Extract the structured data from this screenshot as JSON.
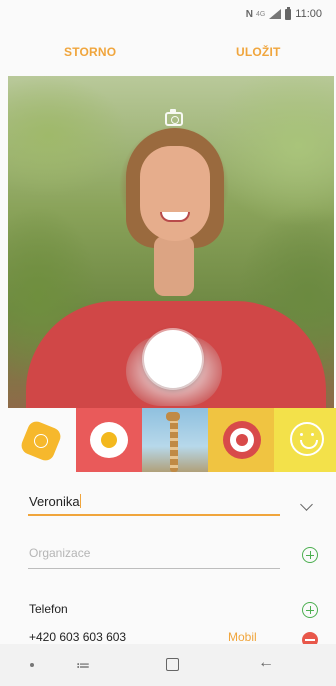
{
  "status_bar": {
    "nfc": "N",
    "network": "4G",
    "time": "11:00"
  },
  "action_bar": {
    "cancel_label": "STORNO",
    "save_label": "ULOŽIT"
  },
  "photo": {
    "camera_icon": "camera-icon",
    "shutter_icon": "shutter-button"
  },
  "stickers": [
    {
      "name": "flower-badge-sticker",
      "background": "#fafafa"
    },
    {
      "name": "fried-egg-sticker",
      "background": "#e95a5a"
    },
    {
      "name": "giraffe-sticker",
      "background": "#8fc0df"
    },
    {
      "name": "target-sticker",
      "background": "#f0c441"
    },
    {
      "name": "smiley-sticker",
      "background": "#f3e14a"
    }
  ],
  "form": {
    "name_value": "Veronika",
    "organization_placeholder": "Organizace",
    "phone_label": "Telefon",
    "phone_number": "+420 603 603 603",
    "phone_type": "Mobil"
  },
  "colors": {
    "accent": "#f0a53c",
    "add": "#4caf50",
    "remove": "#e8574a"
  }
}
